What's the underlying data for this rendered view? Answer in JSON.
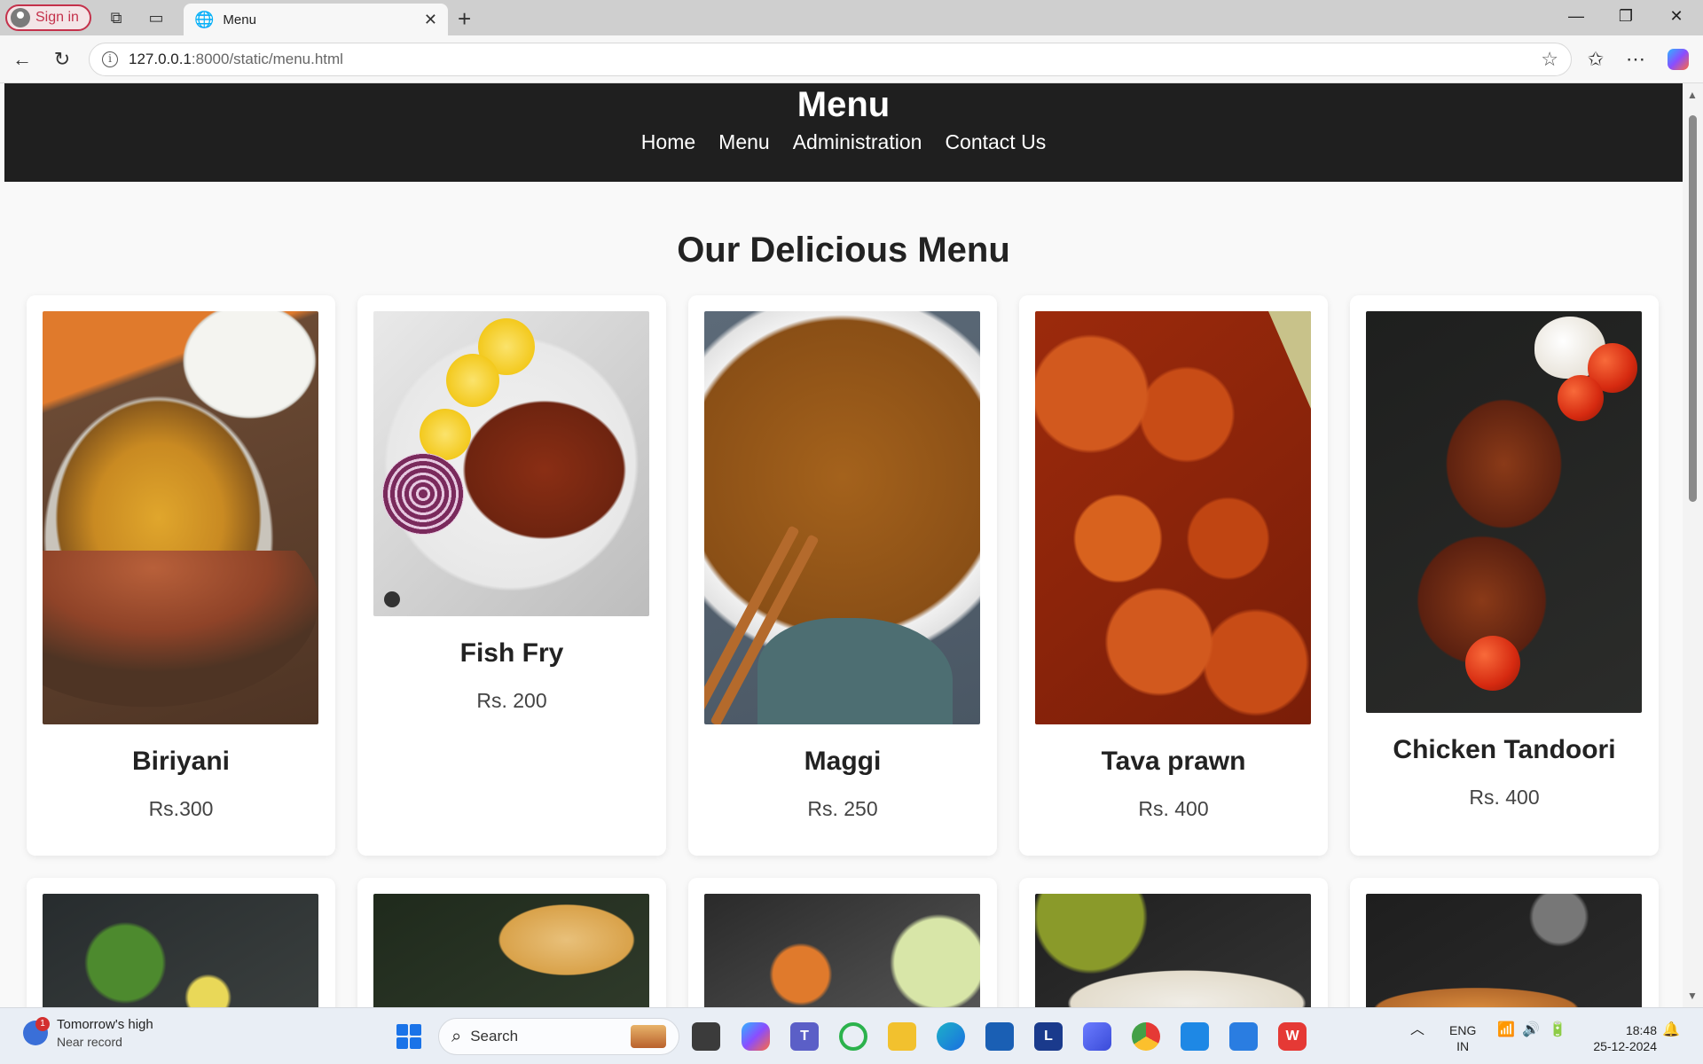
{
  "browser": {
    "signin_label": "Sign in",
    "tab_title": "Menu",
    "url_host": "127.0.0.1",
    "url_rest": ":8000/static/menu.html"
  },
  "site": {
    "title": "Menu",
    "nav": [
      "Home",
      "Menu",
      "Administration",
      "Contact Us"
    ],
    "heading": "Our Delicious Menu"
  },
  "menu_items": [
    {
      "name": "Biriyani",
      "price": "Rs.300"
    },
    {
      "name": "Fish Fry",
      "price": "Rs. 200"
    },
    {
      "name": "Maggi",
      "price": "Rs. 250"
    },
    {
      "name": "Tava prawn",
      "price": "Rs. 400"
    },
    {
      "name": "Chicken Tandoori",
      "price": "Rs. 400"
    }
  ],
  "taskbar": {
    "weather_title": "Tomorrow's high",
    "weather_sub": "Near record",
    "weather_badge": "1",
    "search_label": "Search",
    "lang_line1": "ENG",
    "lang_line2": "IN",
    "time": "18:48",
    "date": "25-12-2024"
  }
}
